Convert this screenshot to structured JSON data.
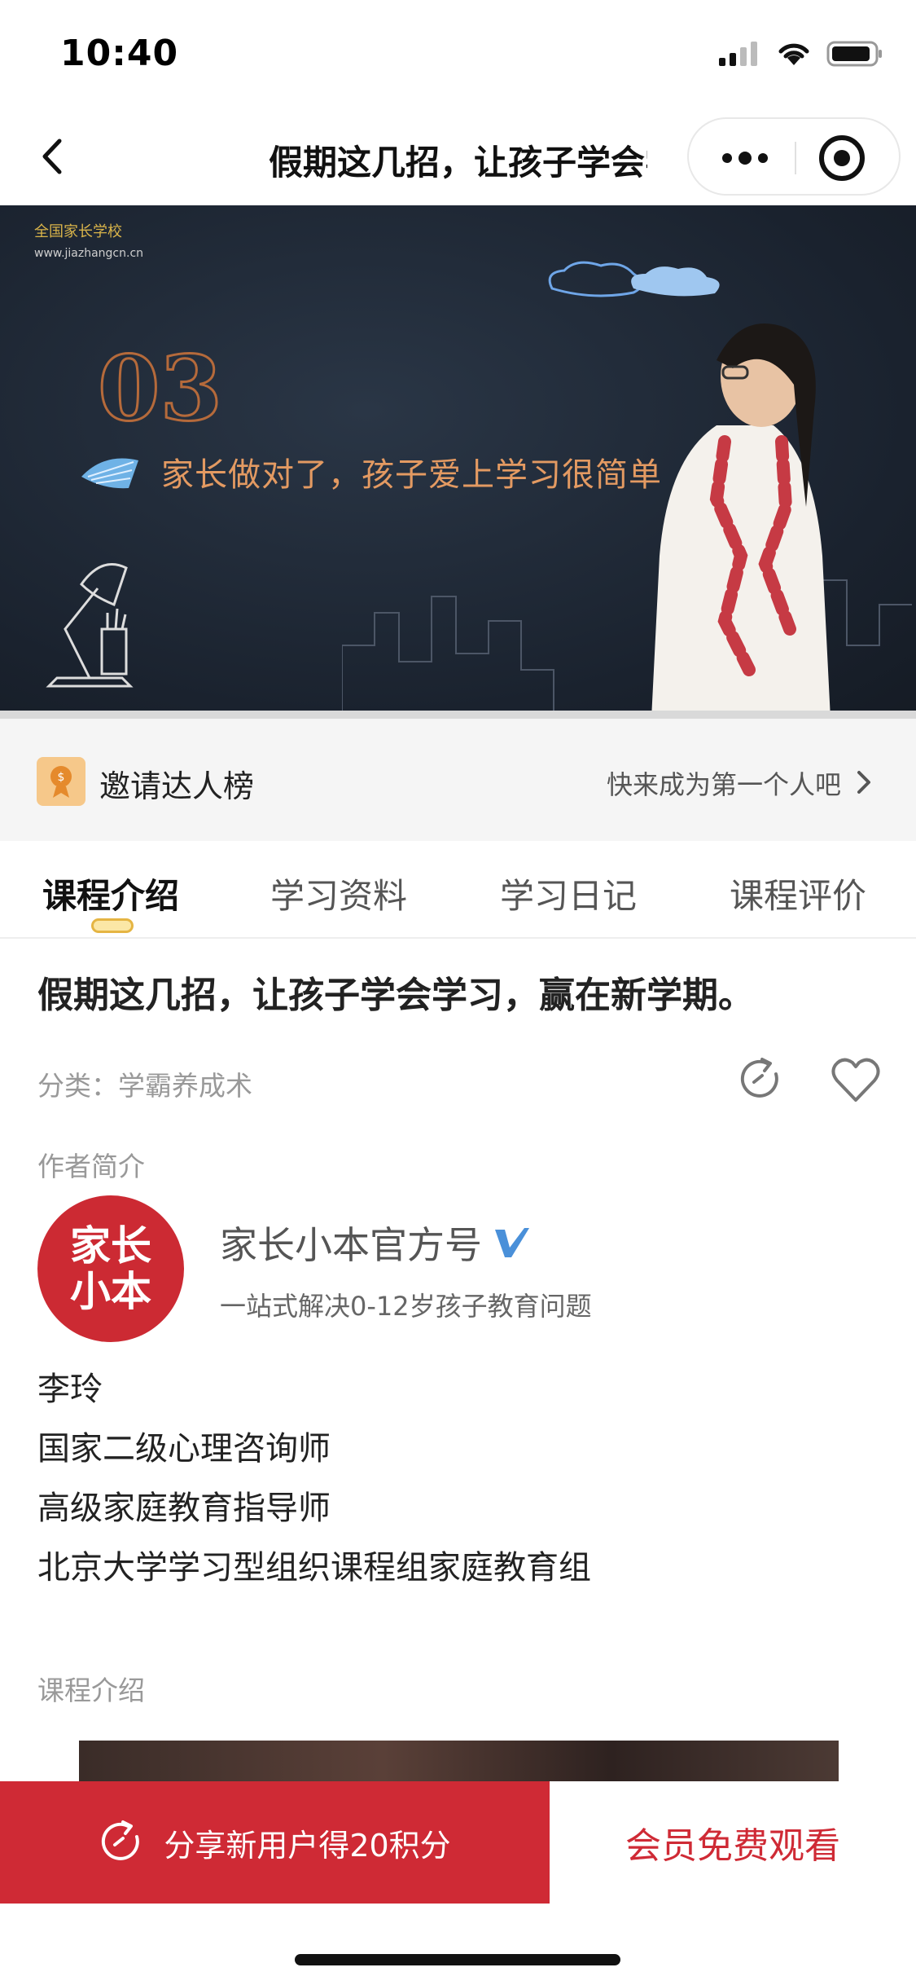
{
  "status_bar": {
    "time": "10:40"
  },
  "nav": {
    "title": "假期这几招，让孩子学会学习，赢在新学期。"
  },
  "video": {
    "school_name": "全国家长学校",
    "school_url": "www.jiazhangcn.cn",
    "episode_number": "03",
    "episode_caption": "家长做对了，孩子爱上学习很简单"
  },
  "invite": {
    "label": "邀请达人榜",
    "hint": "快来成为第一个人吧"
  },
  "tabs": [
    {
      "label": "课程介绍",
      "active": true
    },
    {
      "label": "学习资料",
      "active": false
    },
    {
      "label": "学习日记",
      "active": false
    },
    {
      "label": "课程评价",
      "active": false
    }
  ],
  "course": {
    "title": "假期这几招，让孩子学会学习，赢在新学期。",
    "category": "分类：学霸养成术"
  },
  "author": {
    "section_label": "作者简介",
    "avatar_text_top": "家长",
    "avatar_text_bottom": "小本",
    "name": "家长小本官方号",
    "description": "一站式解决0-12岁孩子教育问题",
    "bio": [
      "李玲",
      "国家二级心理咨询师",
      "高级家庭教育指导师",
      "北京大学学习型组织课程组家庭教育组"
    ]
  },
  "intro": {
    "section_label": "课程介绍"
  },
  "bottom": {
    "share_label": "分享新用户得20积分",
    "member_label": "会员免费观看"
  },
  "colors": {
    "accent": "#cf2a35",
    "tab_indicator": "#e5b543"
  }
}
